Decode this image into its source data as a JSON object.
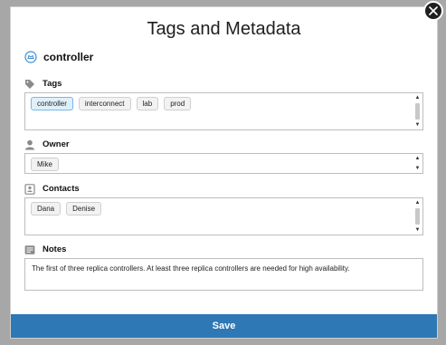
{
  "dialog": {
    "title": "Tags and Metadata",
    "close_label": "×",
    "entity_name": "controller"
  },
  "tags": {
    "label": "Tags",
    "values": [
      "controller",
      "interconnect",
      "lab",
      "prod"
    ],
    "selected": "controller"
  },
  "owner": {
    "label": "Owner",
    "values": [
      "Mike"
    ]
  },
  "contacts": {
    "label": "Contacts",
    "values": [
      "Dana",
      "Denise"
    ]
  },
  "notes": {
    "label": "Notes",
    "text": "The first of three replica controllers. At least three replica controllers are needed for high availability."
  },
  "actions": {
    "save_label": "Save"
  },
  "colors": {
    "accent": "#2e78b6",
    "selected_chip_bg": "#dff0fb",
    "selected_chip_border": "#7ab7e6",
    "icon_blue": "#3a8fd6"
  },
  "icons": {
    "entity": "controller-icon",
    "tags": "tag-icon",
    "owner": "person-icon",
    "contacts": "contacts-icon",
    "notes": "notes-icon",
    "close": "close-icon"
  }
}
